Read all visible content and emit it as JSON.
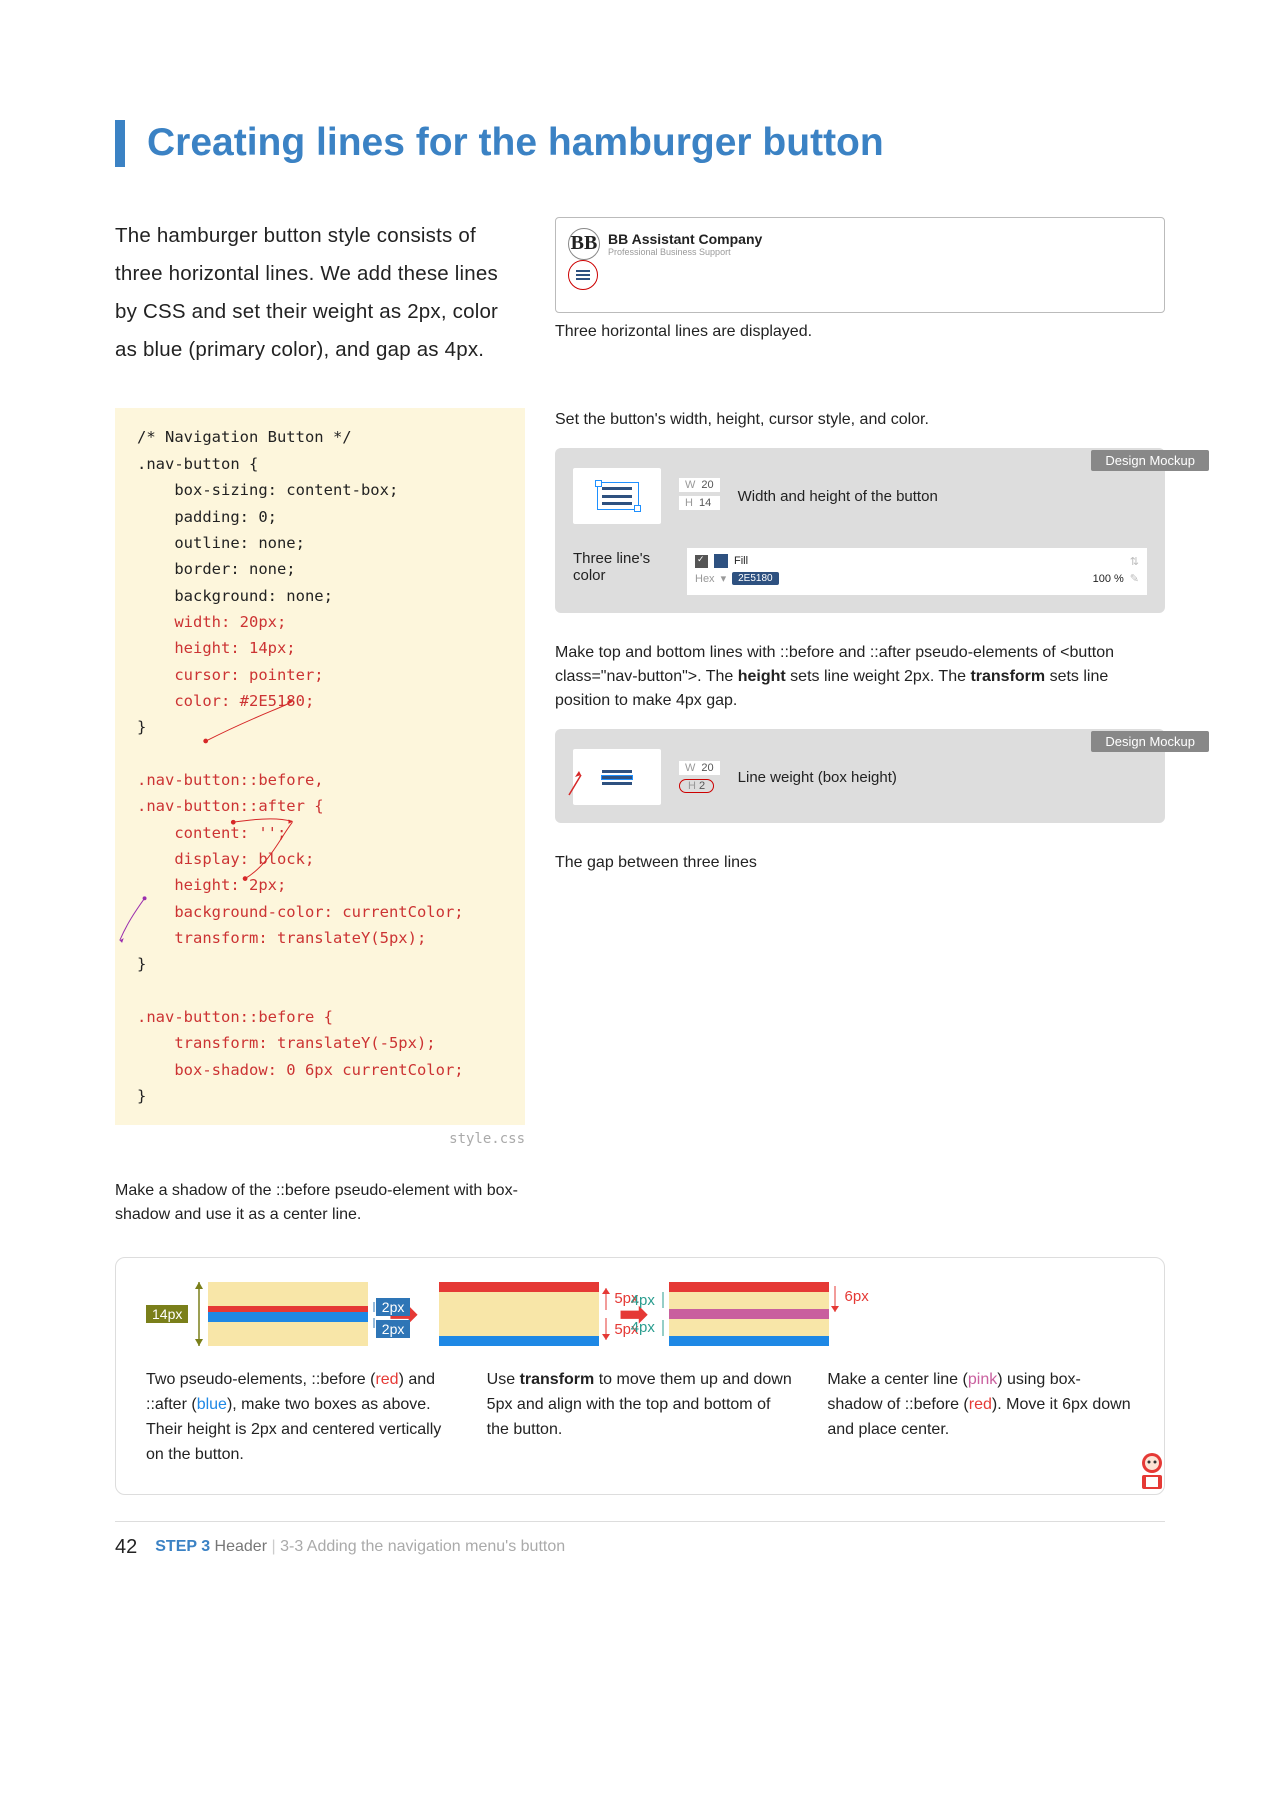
{
  "title": "Creating lines for the hamburger button",
  "intro": "The hamburger button style consists of three horizontal lines. We add these lines by CSS and set their weight as 2px, color as blue (primary color), and gap as 4px.",
  "preview": {
    "company_name": "BB Assistant Company",
    "company_sub": "Professional Business Support",
    "logo_text": "BB",
    "caption": "Three horizontal lines are displayed."
  },
  "code": {
    "filename": "style.css",
    "line1": "/* Navigation Button */",
    "sel1": ".nav-button {",
    "p_boxsizing": "    box-sizing: content-box;",
    "p_padding": "    padding: 0;",
    "p_outline": "    outline: none;",
    "p_border": "    border: none;",
    "p_bg": "    background: none;",
    "p_width": "    width: 20px;",
    "p_height": "    height: 14px;",
    "p_cursor": "    cursor: pointer;",
    "p_color": "    color: #2E5180;",
    "close1": "}",
    "sel2a": ".nav-button::before,",
    "sel2b": ".nav-button::after {",
    "p_content": "    content: '';",
    "p_display": "    display: block;",
    "p_h2": "    height: 2px;",
    "p_bgc": "    background-color: currentColor;",
    "p_tf": "    transform: translateY(5px);",
    "close2": "}",
    "sel3": ".nav-button::before {",
    "p_tf2": "    transform: translateY(-5px);",
    "p_bs": "    box-shadow: 0 6px currentColor;",
    "close3": "}"
  },
  "notes": {
    "n1": "Set the button's width, height, cursor style, and color.",
    "n2": "Make top and bottom lines with ::before and ::after pseudo-elements of <button class=\"nav-button\">. The height sets line weight 2px. The transform sets line position to make 4px gap.",
    "below_code": "Make a shadow of the ::before pseudo-element with box-shadow and use it as a center line.",
    "mockup_tag": "Design Mockup",
    "m1_wh_label": "Width and height of the button",
    "m1_w": "20",
    "m1_h": "14",
    "m1_colorlabel": "Three line's color",
    "m1_fill": "Fill",
    "m1_hex": "Hex",
    "m1_hexval": "2E5180",
    "m1_pct": "100 %",
    "m2_label": "Line weight (box height)",
    "m2_w": "20",
    "m2_h": "2",
    "m2_caption": "The gap between three lines"
  },
  "explain": {
    "dim_14": "14px",
    "dim_2a": "2px",
    "dim_2b": "2px",
    "dim_5a": "5px",
    "dim_5b": "5px",
    "dim_4a": "4px",
    "dim_4b": "4px",
    "dim_6": "6px",
    "t1_a": "Two pseudo-elements, ::before (",
    "t1_red": "red",
    "t1_b": ") and ::after (",
    "t1_blue": "blue",
    "t1_c": "), make two boxes as above. Their height is 2px and centered vertically on the button.",
    "t2": "Use transform to move them up and down 5px and align with the top and bottom of the button.",
    "t3_a": "Make a center line (",
    "t3_pink": "pink",
    "t3_b": ") using box-shadow of ::before (",
    "t3_red": "red",
    "t3_c": "). Move it 6px down and place center."
  },
  "footer": {
    "page": "42",
    "step": "STEP 3",
    "step_title": "Header",
    "section": "3-3 Adding the navigation menu's button"
  }
}
